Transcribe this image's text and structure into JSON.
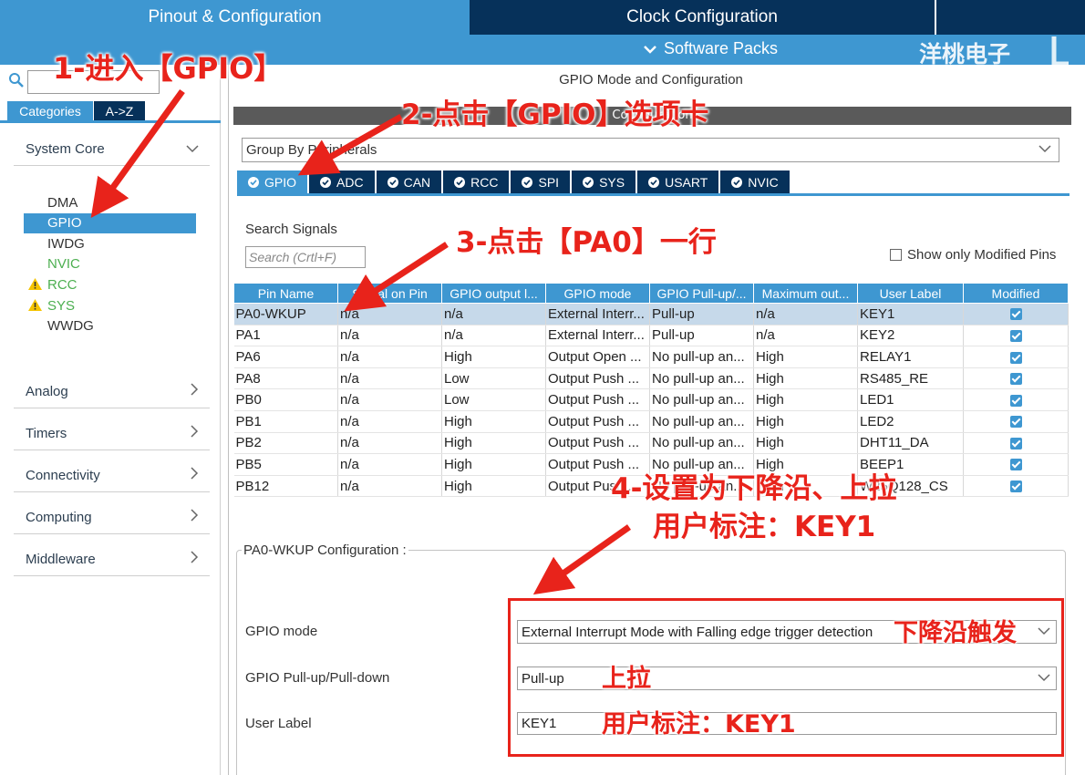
{
  "tabs": {
    "pinout": "Pinout & Configuration",
    "clock": "Clock Configuration",
    "software_packs": "Software Packs"
  },
  "watermark": "洋桃电子",
  "left": {
    "categories_tab": "Categories",
    "az_tab": "A->Z",
    "system_core": "System Core",
    "system_items": [
      {
        "label": "DMA",
        "state": "normal"
      },
      {
        "label": "GPIO",
        "state": "selected"
      },
      {
        "label": "IWDG",
        "state": "normal"
      },
      {
        "label": "NVIC",
        "state": "green"
      },
      {
        "label": "RCC",
        "state": "warning"
      },
      {
        "label": "SYS",
        "state": "warning"
      },
      {
        "label": "WWDG",
        "state": "normal"
      }
    ],
    "categories": [
      "Analog",
      "Timers",
      "Connectivity",
      "Computing",
      "Middleware"
    ]
  },
  "main": {
    "mode_title": "GPIO Mode and Configuration",
    "config_title": "Configuration",
    "group_by": "Group By Peripherals",
    "periph_tabs": [
      "GPIO",
      "ADC",
      "CAN",
      "RCC",
      "SPI",
      "SYS",
      "USART",
      "NVIC"
    ],
    "search_signals_label": "Search Signals",
    "search_placeholder": "Search (Crtl+F)",
    "show_modified": "Show only Modified Pins"
  },
  "table": {
    "headers": [
      "Pin Name",
      "Signal on Pin",
      "GPIO output l...",
      "GPIO mode",
      "GPIO Pull-up/...",
      "Maximum out...",
      "User Label",
      "Modified"
    ],
    "rows": [
      [
        "PA0-WKUP",
        "n/a",
        "n/a",
        "External Interr...",
        "Pull-up",
        "n/a",
        "KEY1"
      ],
      [
        "PA1",
        "n/a",
        "n/a",
        "External Interr...",
        "Pull-up",
        "n/a",
        "KEY2"
      ],
      [
        "PA6",
        "n/a",
        "High",
        "Output Open ...",
        "No pull-up an...",
        "High",
        "RELAY1"
      ],
      [
        "PA8",
        "n/a",
        "Low",
        "Output Push ...",
        "No pull-up an...",
        "High",
        "RS485_RE"
      ],
      [
        "PB0",
        "n/a",
        "Low",
        "Output Push ...",
        "No pull-up an...",
        "High",
        "LED1"
      ],
      [
        "PB1",
        "n/a",
        "High",
        "Output Push ...",
        "No pull-up an...",
        "High",
        "LED2"
      ],
      [
        "PB2",
        "n/a",
        "High",
        "Output Push ...",
        "No pull-up an...",
        "High",
        "DHT11_DA"
      ],
      [
        "PB5",
        "n/a",
        "High",
        "Output Push ...",
        "No pull-up an...",
        "High",
        "BEEP1"
      ],
      [
        "PB12",
        "n/a",
        "High",
        "Output Push ...",
        "No pull-up an...",
        "High",
        "W25Q128_CS"
      ]
    ]
  },
  "config": {
    "legend": "PA0-WKUP Configuration :",
    "gpio_mode_label": "GPIO mode",
    "gpio_mode_value": "External Interrupt Mode with Falling edge trigger detection",
    "pull_label": "GPIO Pull-up/Pull-down",
    "pull_value": "Pull-up",
    "user_label_label": "User Label",
    "user_label_value": "KEY1"
  },
  "annotations": {
    "step1": "1-进入【GPIO】",
    "step2": "2-点击【GPIO】选项卡",
    "step3": "3-点击【PA0】一行",
    "step4_line1": "4-设置为下降沿、上拉",
    "step4_line2": "用户标注：KEY1",
    "note_falling": "下降沿触发",
    "note_pullup": "上拉",
    "note_label": "用户标注：KEY1"
  },
  "colors": {
    "accent": "#3e97d1",
    "dark_tab": "#06315a",
    "annotation_red": "#e8231b"
  }
}
